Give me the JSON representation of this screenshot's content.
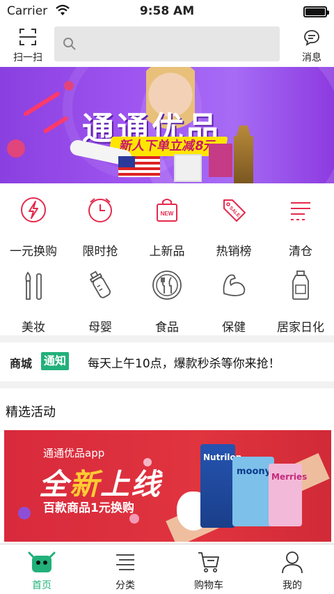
{
  "status_bar": {
    "carrier": "Carrier",
    "time": "9:58 AM"
  },
  "header": {
    "scan_label": "扫一扫",
    "search_placeholder": "",
    "messages_label": "消息"
  },
  "banner": {
    "title": "通通优品",
    "subtitle": "新人下单立减8元"
  },
  "categories_row1": [
    {
      "label": "一元换购",
      "icon": "lightning-icon"
    },
    {
      "label": "限时抢",
      "icon": "clock-icon"
    },
    {
      "label": "上新品",
      "icon": "shopping-bag-new-icon"
    },
    {
      "label": "热销榜",
      "icon": "sale-tag-icon"
    },
    {
      "label": "清仓",
      "icon": "menu-lines-icon"
    }
  ],
  "categories_row2": [
    {
      "label": "美妆",
      "icon": "makeup-brush-icon"
    },
    {
      "label": "母婴",
      "icon": "baby-bottle-icon"
    },
    {
      "label": "食品",
      "icon": "plate-cutlery-icon"
    },
    {
      "label": "保健",
      "icon": "muscle-arm-icon"
    },
    {
      "label": "居家日化",
      "icon": "detergent-bottle-icon"
    }
  ],
  "notice": {
    "logo_text": "商城",
    "tag": "通知",
    "text": "每天上午10点，爆款秒杀等你来抢！"
  },
  "featured": {
    "heading": "精选活动",
    "promo": {
      "app_name": "通通优品app",
      "headline_a": "全",
      "headline_b": "新",
      "headline_c": "上线",
      "tagline": "百款商品1元换购",
      "product_1": "Nutrilon",
      "product_2": "moony",
      "product_3": "Merries"
    }
  },
  "tabbar": {
    "items": [
      {
        "label": "首页",
        "icon": "home-mascot-icon",
        "active": true
      },
      {
        "label": "分类",
        "icon": "list-icon",
        "active": false
      },
      {
        "label": "购物车",
        "icon": "cart-icon",
        "active": false
      },
      {
        "label": "我的",
        "icon": "profile-icon",
        "active": false
      }
    ]
  },
  "colors": {
    "accent_red": "#e5294d",
    "accent_green": "#21b07a",
    "banner_purple": "#9f55f0",
    "promo_red": "#d82a3c"
  }
}
